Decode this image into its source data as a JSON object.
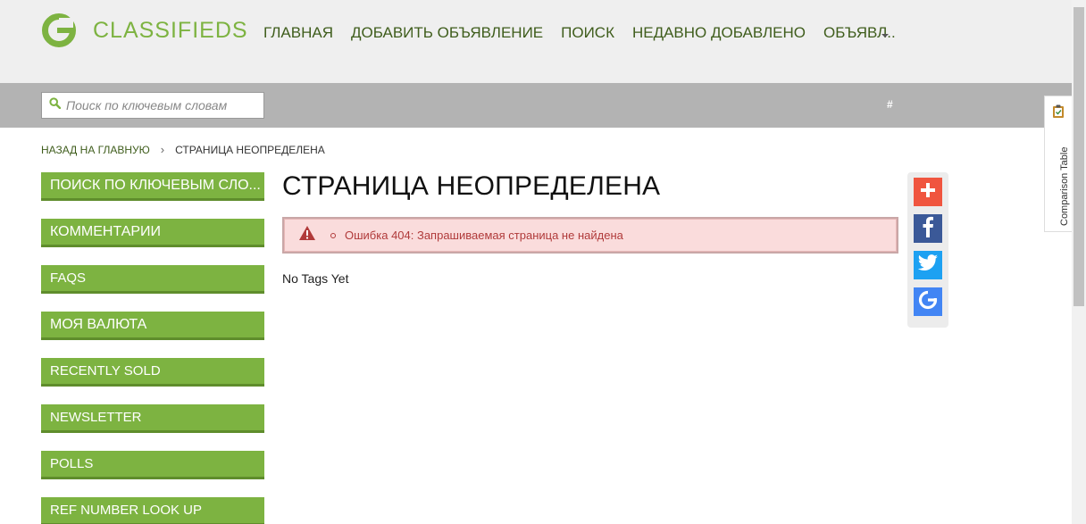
{
  "header": {
    "brand": "CLASSIFIEDS",
    "logo_letter": "G",
    "nav": [
      "ГЛАВНАЯ",
      "ДОБАВИТЬ ОБЪЯВЛЕНИЕ",
      "ПОИСК",
      "НЕДАВНО ДОБАВЛЕНО",
      "ОБЪЯВЛ.."
    ]
  },
  "search": {
    "placeholder": "Поиск по ключевым словам",
    "hash": "#"
  },
  "breadcrumb": {
    "back": "НАЗАД НА ГЛАВНУЮ",
    "current": "СТРАНИЦА НЕОПРЕДЕЛЕНА"
  },
  "sidebar": {
    "items": [
      {
        "label": "ПОИСК ПО КЛЮЧЕВЫМ СЛО..."
      },
      {
        "label": "КОММЕНТАРИИ"
      },
      {
        "label": "FAQS"
      },
      {
        "label": "МОЯ ВАЛЮТА"
      },
      {
        "label": "RECENTLY SOLD"
      },
      {
        "label": "NEWSLETTER"
      },
      {
        "label": "POLLS"
      },
      {
        "label": "REF NUMBER LOOK UP"
      }
    ]
  },
  "main": {
    "title": "СТРАНИЦА НЕОПРЕДЕЛЕНА",
    "error": "Ошибка 404: Запрашиваемая страница не найдена",
    "tags": "No Tags Yet"
  },
  "share": {
    "buttons": [
      {
        "icon": "plus-icon",
        "color": "#f0553f"
      },
      {
        "icon": "facebook-icon",
        "color": "#3b5998"
      },
      {
        "icon": "twitter-icon",
        "color": "#1da1f2"
      },
      {
        "icon": "google-icon",
        "color": "#4285f4"
      }
    ]
  },
  "comparison": {
    "label": "Comparison Table"
  },
  "colors": {
    "brand_green": "#7db341",
    "nav_text": "#3f5d1c",
    "error_bg": "#fadcdc",
    "error_text": "#b03a3a"
  }
}
